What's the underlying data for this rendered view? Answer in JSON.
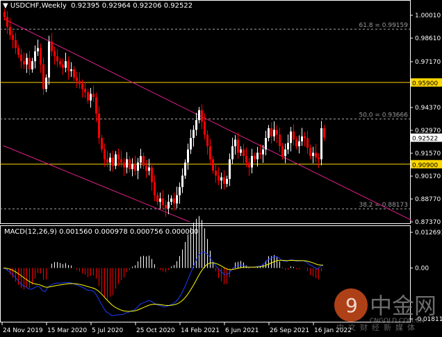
{
  "header": {
    "symbol_timeframe": "USDCHF,Weekly",
    "ohlc": "0.92395 0.92964 0.92206 0.92522"
  },
  "macd_header": "MACD(12,26,9) 0.001560 0.000978 0.000756 0.000000",
  "watermark": {
    "brand": "中金网",
    "domain": "CNGOLD.COM.CN",
    "tagline": "中文财经新媒体"
  },
  "colors": {
    "background": "#000000",
    "bull": "#ffffff",
    "bear": "#ff0000",
    "level": "#ffd700",
    "channel": "#e0208a",
    "macd": "#1e3cff",
    "signal": "#ffff00"
  },
  "chart_data": [
    {
      "type": "candlestick",
      "title": "USDCHF,Weekly",
      "ylim": [
        0.8737,
        1.0001
      ],
      "yticks": [
        "1.00010",
        "0.98610",
        "0.97170",
        "0.95770",
        "0.94370",
        "0.92970",
        "0.91570",
        "0.90170",
        "0.88770",
        "0.87370"
      ],
      "xticks": [
        {
          "bar": 0,
          "label": "24 Nov 2019"
        },
        {
          "bar": 16,
          "label": "15 Mar 2020"
        },
        {
          "bar": 32,
          "label": "5 Jul 2020"
        },
        {
          "bar": 48,
          "label": "25 Oct 2020"
        },
        {
          "bar": 64,
          "label": "14 Feb 2021"
        },
        {
          "bar": 80,
          "label": "6 Jun 2021"
        },
        {
          "bar": 96,
          "label": "26 Sep 2021"
        },
        {
          "bar": 112,
          "label": "16 Jan 2022"
        }
      ],
      "closes": [
        0.999,
        0.993,
        0.988,
        0.985,
        0.98,
        0.976,
        0.972,
        0.97,
        0.974,
        0.967,
        0.972,
        0.978,
        0.98,
        0.97,
        0.955,
        0.962,
        0.984,
        0.978,
        0.975,
        0.972,
        0.97,
        0.968,
        0.972,
        0.966,
        0.967,
        0.962,
        0.96,
        0.958,
        0.955,
        0.953,
        0.948,
        0.952,
        0.95,
        0.94,
        0.925,
        0.918,
        0.912,
        0.91,
        0.913,
        0.908,
        0.915,
        0.912,
        0.91,
        0.907,
        0.912,
        0.906,
        0.909,
        0.905,
        0.91,
        0.914,
        0.908,
        0.905,
        0.907,
        0.898,
        0.89,
        0.886,
        0.888,
        0.884,
        0.882,
        0.886,
        0.888,
        0.885,
        0.89,
        0.895,
        0.902,
        0.91,
        0.918,
        0.925,
        0.93,
        0.936,
        0.942,
        0.935,
        0.927,
        0.92,
        0.912,
        0.905,
        0.902,
        0.899,
        0.901,
        0.897,
        0.9,
        0.912,
        0.92,
        0.924,
        0.916,
        0.918,
        0.914,
        0.91,
        0.907,
        0.914,
        0.912,
        0.916,
        0.915,
        0.918,
        0.925,
        0.931,
        0.926,
        0.93,
        0.927,
        0.92,
        0.914,
        0.918,
        0.922,
        0.929,
        0.924,
        0.92,
        0.923,
        0.926,
        0.925,
        0.919,
        0.914,
        0.916,
        0.913,
        0.912,
        0.931,
        0.92522
      ],
      "last_price": "0.92522",
      "levels": [
        {
          "price": 0.959,
          "label": "0.95900"
        },
        {
          "price": 0.909,
          "label": "0.90900"
        }
      ],
      "fibonacci": [
        {
          "price": 0.99159,
          "label": "61.8 = 0.99159"
        },
        {
          "price": 0.93666,
          "label": "50.0 = 0.93666"
        },
        {
          "price": 0.88173,
          "label": "38.2 = 0.88173"
        }
      ],
      "channel_lines": [
        {
          "from": [
            0,
            0.998
          ],
          "to": [
            147,
            0.8745
          ]
        },
        {
          "from": [
            0,
            0.9203
          ],
          "to": [
            67,
            0.8737
          ]
        }
      ]
    },
    {
      "type": "macd",
      "params": [
        12,
        26,
        9
      ],
      "ylim": [
        -0.018118,
        0.012691
      ],
      "yticks": [
        "0.012691",
        "0.00",
        "-0.018118"
      ]
    }
  ]
}
